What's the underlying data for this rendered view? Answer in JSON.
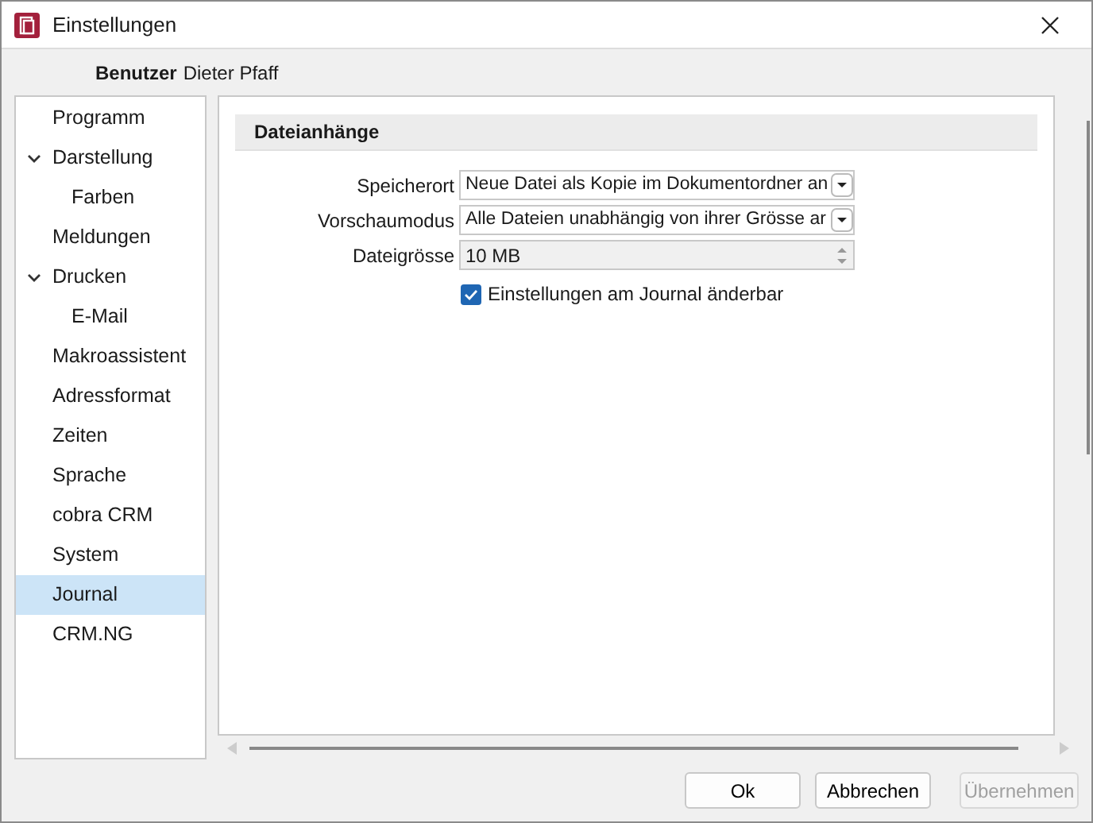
{
  "window": {
    "title": "Einstellungen"
  },
  "user": {
    "label": "Benutzer",
    "value": "Dieter Pfaff"
  },
  "sidebar": {
    "items": [
      {
        "label": "Programm",
        "selected": false
      },
      {
        "label": "Darstellung",
        "selected": false,
        "expanded": true,
        "children": [
          {
            "label": "Farben",
            "selected": false
          }
        ]
      },
      {
        "label": "Meldungen",
        "selected": false
      },
      {
        "label": "Drucken",
        "selected": false,
        "expanded": true,
        "children": [
          {
            "label": "E-Mail",
            "selected": false
          }
        ]
      },
      {
        "label": "Makroassistent",
        "selected": false
      },
      {
        "label": "Adressformat",
        "selected": false
      },
      {
        "label": "Zeiten",
        "selected": false
      },
      {
        "label": "Sprache",
        "selected": false
      },
      {
        "label": "cobra CRM",
        "selected": false
      },
      {
        "label": "System",
        "selected": false
      },
      {
        "label": "Journal",
        "selected": true
      },
      {
        "label": "CRM.NG",
        "selected": false
      }
    ]
  },
  "section": {
    "title": "Dateianhänge",
    "fields": [
      {
        "kind": "dropdown",
        "label": "Speicherort",
        "value": "Neue Datei als Kopie im Dokumentordner an"
      },
      {
        "kind": "dropdown",
        "label": "Vorschaumodus",
        "value": "Alle Dateien unabhängig von ihrer Grösse ar"
      },
      {
        "kind": "spinner",
        "label": "Dateigrösse",
        "value": "10 MB"
      }
    ],
    "checkbox": {
      "label": "Einstellungen am Journal änderbar",
      "checked": true
    }
  },
  "buttons": [
    {
      "label": "Ok",
      "disabled": false
    },
    {
      "label": "Abbrechen",
      "disabled": false
    },
    {
      "label": "Übernehmen",
      "disabled": true
    }
  ]
}
